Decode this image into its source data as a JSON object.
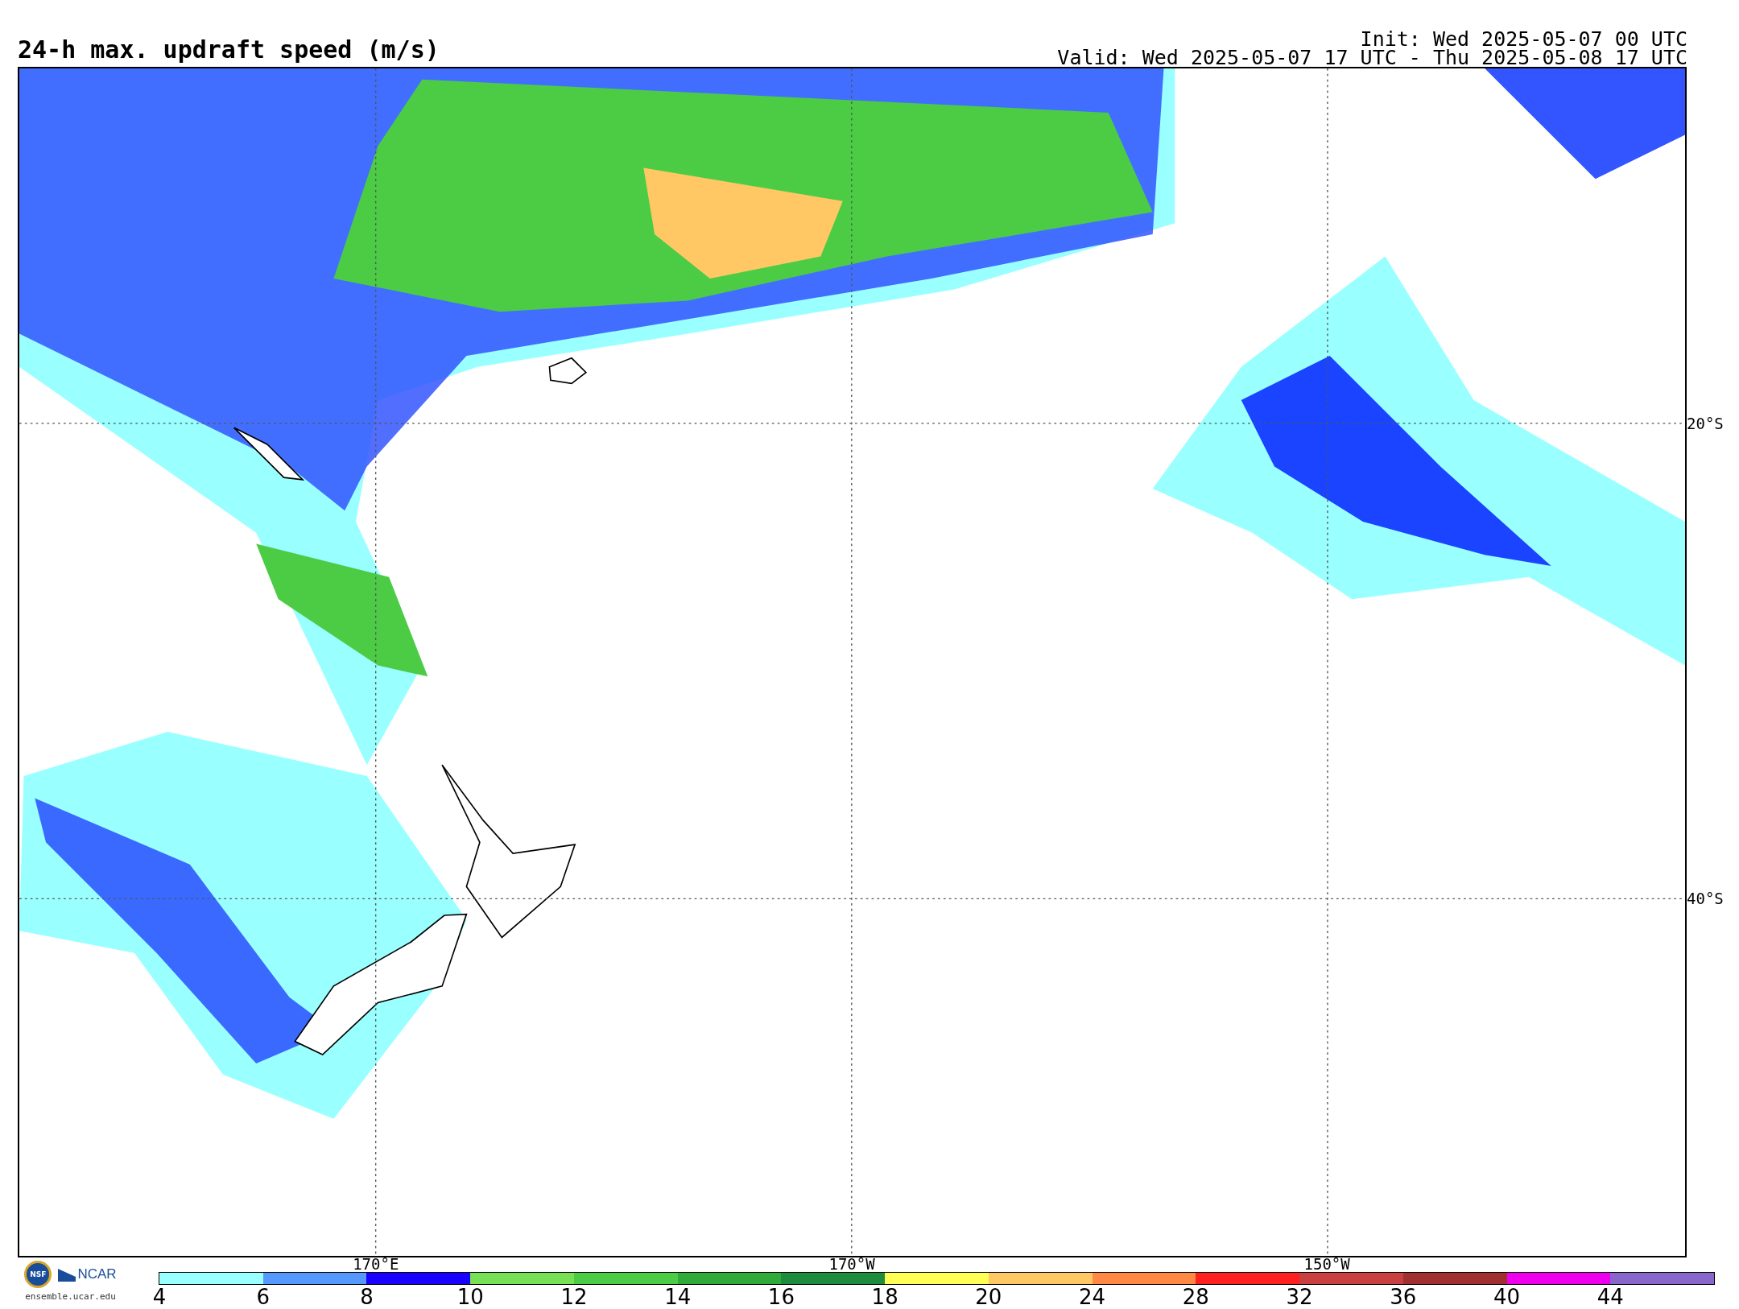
{
  "header": {
    "title": "24-h max. updraft speed (m/s)",
    "init": "Init: Wed 2025-05-07 00 UTC",
    "valid": "Valid: Wed 2025-05-07 17 UTC - Thu 2025-05-08 17 UTC"
  },
  "map": {
    "latitude_labels": [
      "20°S",
      "40°S"
    ],
    "longitude_labels": [
      "170°E",
      "170°W",
      "150°W"
    ]
  },
  "legend": {
    "bins": [
      {
        "label": "4",
        "color": "#99ffff"
      },
      {
        "label": "6",
        "color": "#5599ff"
      },
      {
        "label": "8",
        "color": "#1a00ff"
      },
      {
        "label": "10",
        "color": "#77e055"
      },
      {
        "label": "12",
        "color": "#4ccc44"
      },
      {
        "label": "14",
        "color": "#30aa38"
      },
      {
        "label": "16",
        "color": "#1e8c3c"
      },
      {
        "label": "18",
        "color": "#ffff55"
      },
      {
        "label": "20",
        "color": "#ffc864"
      },
      {
        "label": "24",
        "color": "#ff8844"
      },
      {
        "label": "28",
        "color": "#ff2020"
      },
      {
        "label": "32",
        "color": "#c84040"
      },
      {
        "label": "36",
        "color": "#a03030"
      },
      {
        "label": "40",
        "color": "#ee00ee"
      },
      {
        "label": "44",
        "color": "#8866cc"
      }
    ]
  },
  "footer": {
    "logo_left": "NSF",
    "logo_right": "NCAR",
    "site": "ensemble.ucar.edu"
  }
}
